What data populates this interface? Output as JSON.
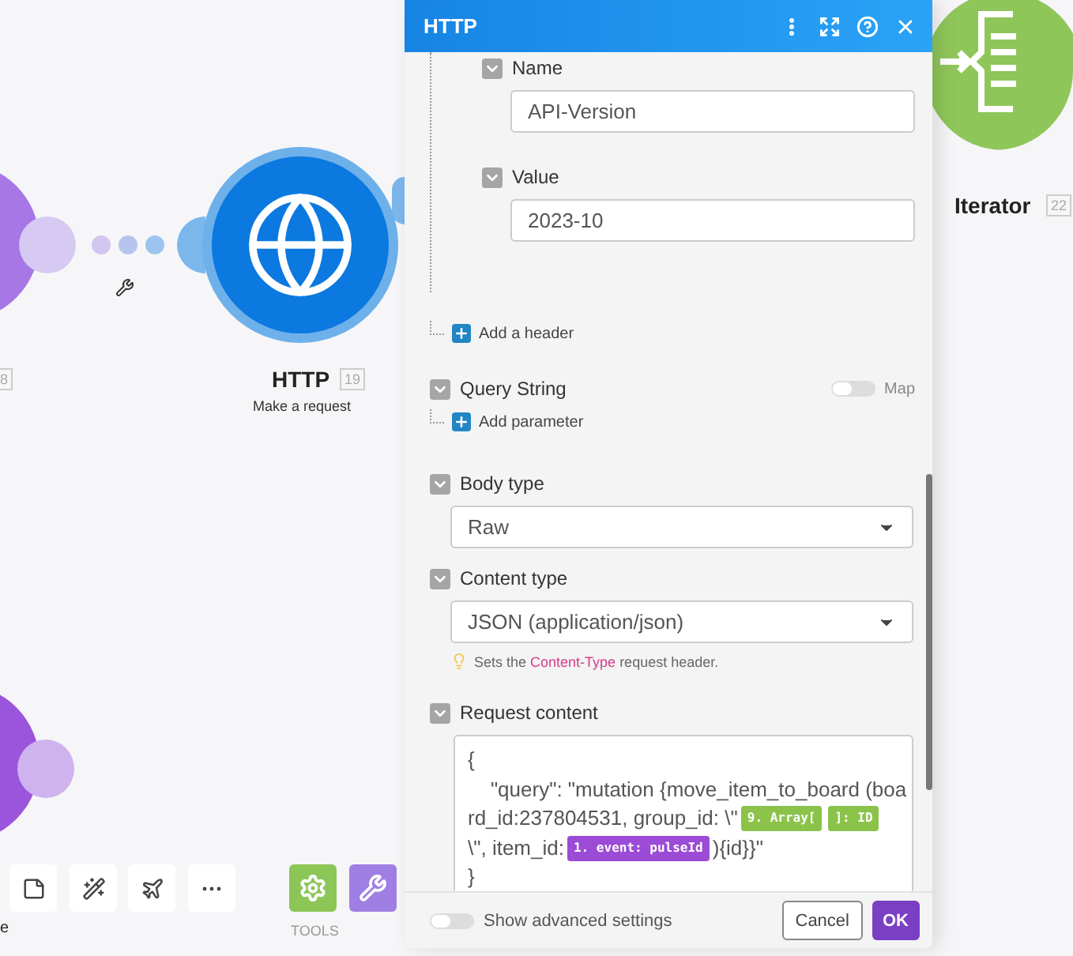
{
  "canvas": {
    "nodes": [
      {
        "kind": "partial",
        "badge": "8"
      },
      {
        "kind": "http",
        "title": "HTTP",
        "badge": "19",
        "subtitle": "Make a request"
      },
      {
        "kind": "iterator",
        "title": "Iterator",
        "badge": "22"
      }
    ],
    "toolbar": {
      "partial_label": "e"
    },
    "tools": {
      "label": "TOOLS"
    }
  },
  "panel": {
    "title": "HTTP",
    "header_fields": [
      {
        "label": "Name",
        "value": "API-Version"
      },
      {
        "label": "Value",
        "value": "2023-10"
      }
    ],
    "add_header": "Add a header",
    "query_string": {
      "label": "Query String",
      "map_label": "Map",
      "map_on": false,
      "add_label": "Add parameter"
    },
    "body_type": {
      "label": "Body type",
      "value": "Raw"
    },
    "content_type": {
      "label": "Content type",
      "value": "JSON (application/json)",
      "hint": [
        {
          "kind": "text",
          "text": "Sets the "
        },
        {
          "kind": "code",
          "text": "Content-Type"
        },
        {
          "kind": "text",
          "text": " request header."
        }
      ]
    },
    "request_content": {
      "label": "Request content",
      "lines": [
        [
          {
            "kind": "text",
            "text": "{"
          }
        ],
        [
          {
            "kind": "text",
            "text": "    \"query\": \"mutation {move_item_to_board (boa"
          }
        ],
        [
          {
            "kind": "text",
            "text": "rd_id:237804531, group_id: \\\""
          },
          {
            "kind": "pill",
            "text": "9. Array[",
            "color": "#8bc34a"
          },
          {
            "kind": "pill",
            "text": "]: ID",
            "color": "#8bc34a"
          }
        ],
        [
          {
            "kind": "text",
            "text": "\\\", item_id:"
          },
          {
            "kind": "pill",
            "text": "1. event: pulseId",
            "color": "#9b4bd6"
          },
          {
            "kind": "text",
            "text": "){id}}\""
          }
        ],
        [
          {
            "kind": "text",
            "text": "}"
          }
        ]
      ]
    },
    "footer": {
      "advanced_label": "Show advanced settings",
      "advanced_on": false,
      "cancel": "Cancel",
      "ok": "OK"
    }
  }
}
